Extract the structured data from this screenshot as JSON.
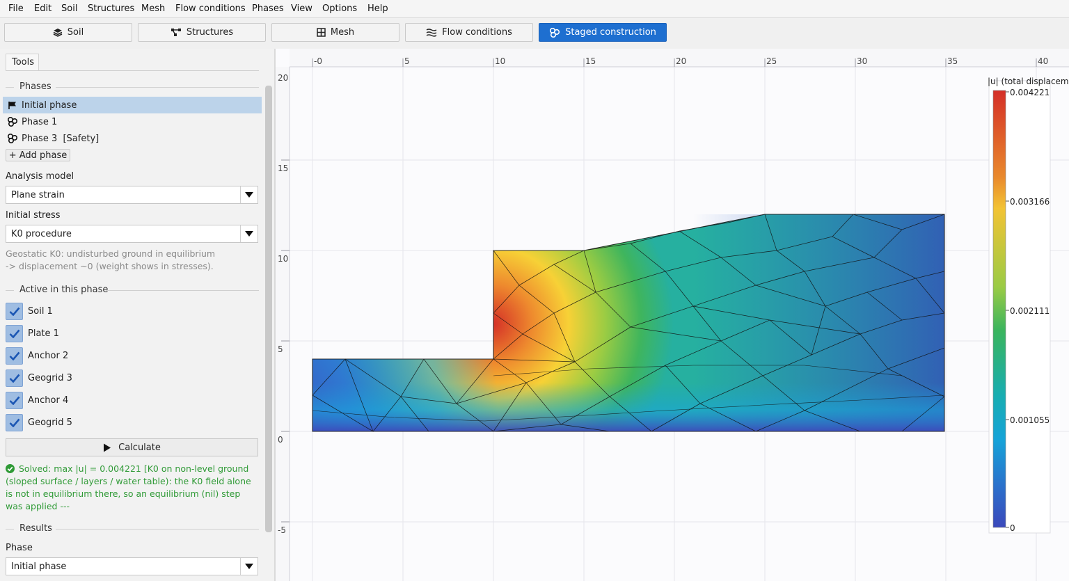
{
  "menu": [
    "File",
    "Edit",
    "Soil",
    "Structures",
    "Mesh",
    "Flow conditions",
    "Phases",
    "View",
    "Options",
    "Help"
  ],
  "toolbar": {
    "tabs": [
      {
        "label": "Soil",
        "icon": "layers-icon"
      },
      {
        "label": "Structures",
        "icon": "structure-icon"
      },
      {
        "label": "Mesh",
        "icon": "mesh-icon"
      },
      {
        "label": "Flow conditions",
        "icon": "flow-icon"
      },
      {
        "label": "Staged construction",
        "icon": "staged-construction-icon",
        "active": true
      }
    ],
    "active_color": "#1e6fd0"
  },
  "panel": {
    "tab_label": "Tools",
    "phases_heading": "Phases",
    "phases": [
      {
        "label": "Initial phase",
        "icon": "flag-icon",
        "selected": true
      },
      {
        "label": "Phase 1",
        "icon": "phase-icon"
      },
      {
        "label": "Phase 3  [Safety]",
        "icon": "phase-icon"
      }
    ],
    "add_phase": "+ Add phase",
    "analysis_model_label": "Analysis model",
    "analysis_model_value": "Plane strain",
    "initial_stress_label": "Initial stress",
    "initial_stress_value": "K0 procedure",
    "note_line1": "Geostatic K0: undisturbed ground in equilibrium",
    "note_line2": "-> displacement ~0 (weight shows in stresses).",
    "active_heading": "Active in this phase",
    "active_items": [
      "Soil 1",
      "Plate 1",
      "Anchor 2",
      "Geogrid 3",
      "Anchor 4",
      "Geogrid 5"
    ],
    "calculate_label": "Calculate",
    "status_text": "Solved: max |u| = 0.004221  [K0 on non-level ground (sloped surface / layers / water table): the K0 field alone is not in equilibrium there, so an equilibrium (nil) step was applied ---",
    "status_color": "#2f9a36",
    "results_heading": "Results",
    "result_phase_label": "Phase",
    "result_phase_value": "Initial phase"
  },
  "plot": {
    "x_ticks": [
      "-0",
      "5",
      "10",
      "15",
      "20",
      "25",
      "30",
      "35",
      "40"
    ],
    "y_ticks": [
      "20",
      "15",
      "10",
      "5",
      "0",
      "-5"
    ],
    "legend_title": "|u| (total displaceme",
    "legend_labels": [
      "0.004221",
      "0.003166",
      "0.002111",
      "0.001055",
      "0"
    ]
  }
}
